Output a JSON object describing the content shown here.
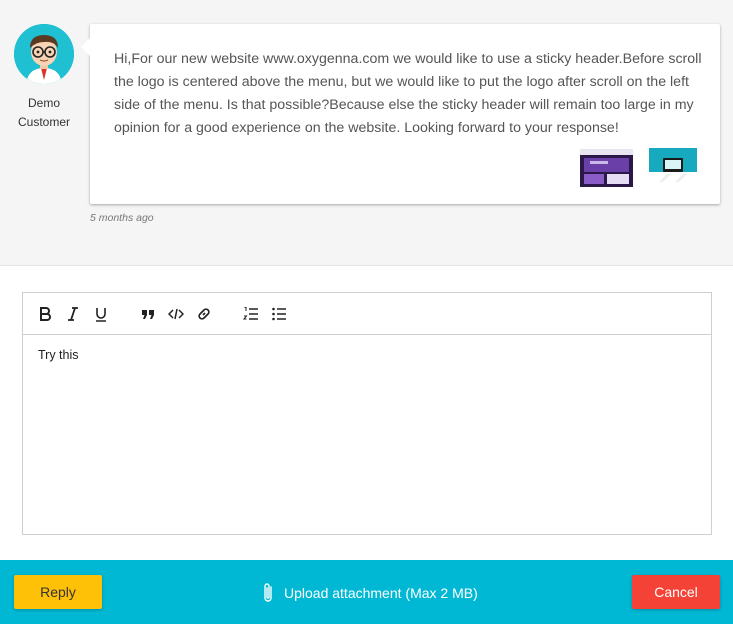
{
  "message": {
    "author_line1": "Demo",
    "author_line2": "Customer",
    "text": "Hi,For our new website www.oxygenna.com we would like to use a sticky header.Before scroll the logo is centered above the menu, but we would like to put the logo after scroll on the left side of the menu. Is that possible?Because else the sticky header will remain too large in my opinion for a good experience on the website. Looking forward to your response!",
    "time_ago": "5 months ago"
  },
  "editor": {
    "content": "Try this",
    "toolbar": [
      "bold-icon",
      "italic-icon",
      "underline-icon",
      "quote-icon",
      "code-icon",
      "link-icon",
      "ordered-list-icon",
      "bullet-list-icon"
    ]
  },
  "footer": {
    "reply_label": "Reply",
    "upload_label": "Upload attachment (Max 2 MB)",
    "cancel_label": "Cancel"
  },
  "colors": {
    "footer_bg": "#00b8d4",
    "reply_bg": "#ffc107",
    "cancel_bg": "#f44336",
    "avatar_bg": "#1ec0d2"
  }
}
